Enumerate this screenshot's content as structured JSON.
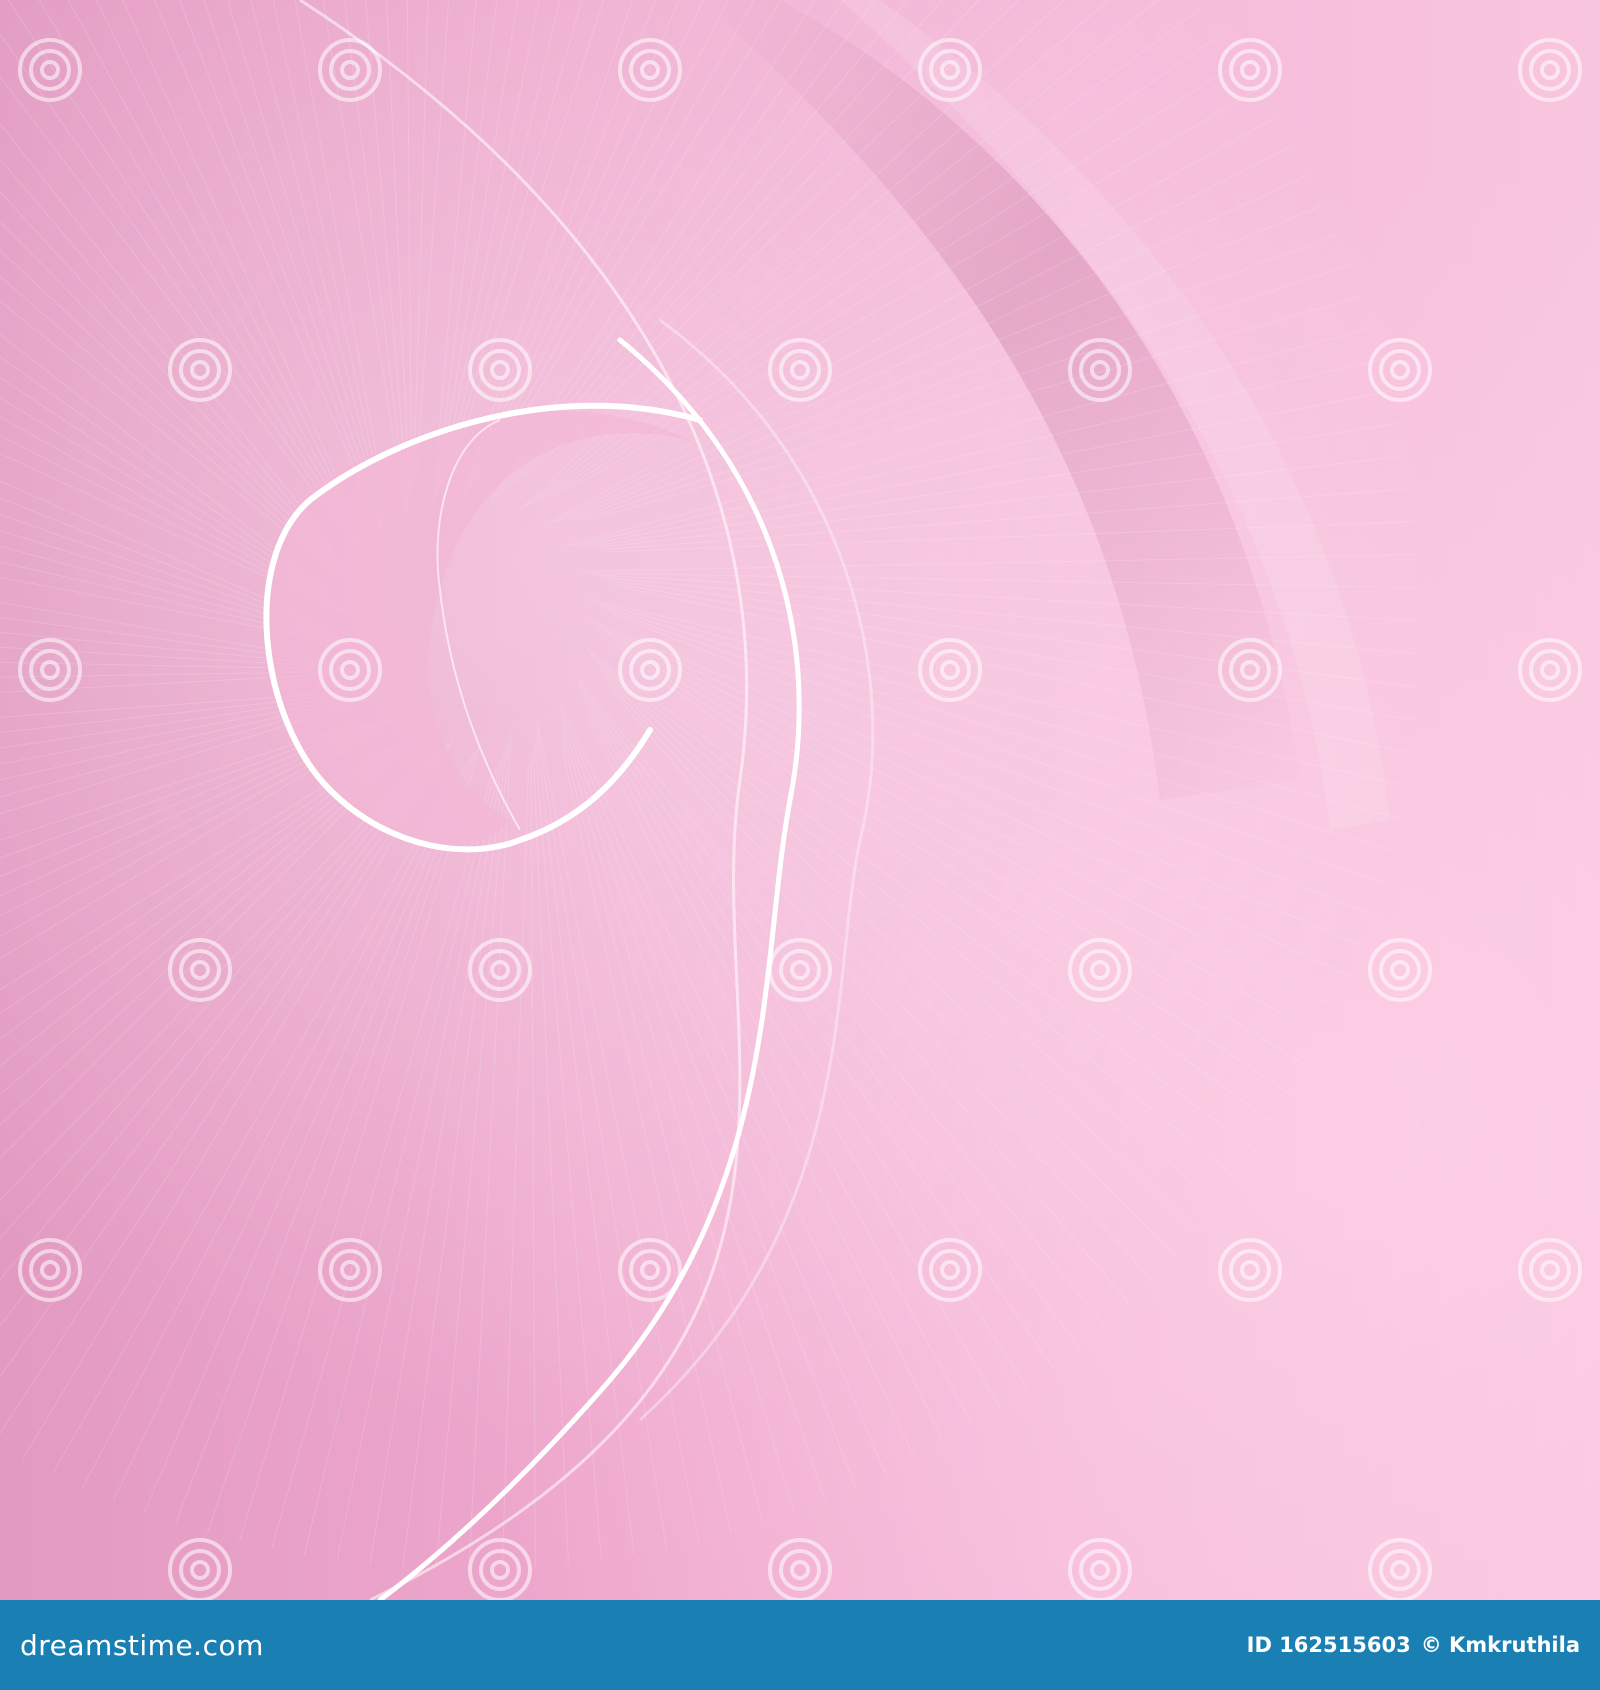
{
  "image": {
    "description": "Abstract pink background with white line spiral",
    "colors": {
      "background_light": "#f7c3df",
      "background_mid": "#f0a9cd",
      "background_dark": "#e19ac0",
      "line": "#ffffff",
      "footer_bg": "#1a7fb3"
    }
  },
  "watermark": {
    "text": "dreamstime",
    "icon": "dreamstime-spiral-icon"
  },
  "footer": {
    "brand": "dreamstime.com",
    "id_text": "ID 162515603",
    "credit": "© Kmkruthila"
  }
}
